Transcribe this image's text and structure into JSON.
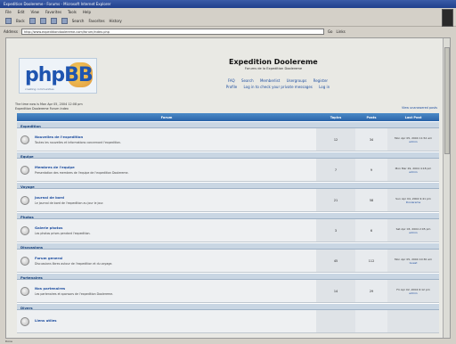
{
  "window": {
    "title": "Expedition Doolereme - Forums - Microsoft Internet Explorer",
    "menu": [
      "File",
      "Edit",
      "View",
      "Favorites",
      "Tools",
      "Help"
    ],
    "toolbar": [
      "Back",
      "Forward",
      "Stop",
      "Refresh",
      "Home",
      "Search",
      "Favorites",
      "History"
    ],
    "address_label": "Address",
    "address_value": "http://www.expeditiondoolereme.com/forum/index.php",
    "go_label": "Go",
    "links_label": "Links"
  },
  "header": {
    "logo_text": "phpBB",
    "logo_sub": "creating communities",
    "site_title": "Expedition Doolereme",
    "site_desc": "Forums de la Expedition Doolereme",
    "nav": [
      "FAQ",
      "Search",
      "Memberlist",
      "Usergroups",
      "Register",
      "Profile",
      "Log in to check your private messages",
      "Log in"
    ]
  },
  "meta": {
    "line1": "The time now is Mon Apr 05, 2004 12:08 pm",
    "line2": "Expedition Doolereme Forum Index",
    "right": "View unanswered posts"
  },
  "table": {
    "headers": [
      "Forum",
      "Topics",
      "Posts",
      "Last Post"
    ],
    "categories": [
      {
        "name": "Expedition",
        "forums": [
          {
            "name": "Nouvelles de l'expedition",
            "desc": "Toutes les nouvelles et informations concernant l'expedition.",
            "topics": "12",
            "posts": "34",
            "last": [
              "Mon Apr 05, 2004 11:52 am",
              "admin"
            ]
          }
        ]
      },
      {
        "name": "Equipe",
        "forums": [
          {
            "name": "Membres de l'equipe",
            "desc": "Presentation des membres de l'equipe de l'expedition Doolereme.",
            "topics": "7",
            "posts": "9",
            "last": [
              "Mon Mar 29, 2004 4:18 pm",
              "admin"
            ]
          }
        ]
      },
      {
        "name": "Voyage",
        "forums": [
          {
            "name": "Journal de bord",
            "desc": "Le journal de bord de l'expedition au jour le jour.",
            "topics": "21",
            "posts": "58",
            "last": [
              "Sun Apr 04, 2004 9:41 pm",
              "Doolereme"
            ]
          }
        ]
      },
      {
        "name": "Photos",
        "forums": [
          {
            "name": "Galerie photos",
            "desc": "Les photos prises pendant l'expedition.",
            "topics": "3",
            "posts": "6",
            "last": [
              "Sat Apr 03, 2004 2:05 pm",
              "admin"
            ]
          }
        ]
      },
      {
        "name": "Discussions",
        "forums": [
          {
            "name": "Forum general",
            "desc": "Discussions libres autour de l'expedition et du voyage.",
            "topics": "45",
            "posts": "112",
            "last": [
              "Mon Apr 05, 2004 10:30 am",
              "Guest"
            ]
          }
        ]
      },
      {
        "name": "Partenaires",
        "forums": [
          {
            "name": "Nos partenaires",
            "desc": "Les partenaires et sponsors de l'expedition Doolereme.",
            "topics": "14",
            "posts": "29",
            "last": [
              "Fri Apr 02, 2004 6:12 pm",
              "admin"
            ]
          }
        ]
      },
      {
        "name": "Divers",
        "forums": [
          {
            "name": "Liens utiles",
            "desc": "",
            "topics": "",
            "posts": "",
            "last": [
              "",
              ""
            ]
          }
        ]
      }
    ]
  },
  "status": "Done"
}
